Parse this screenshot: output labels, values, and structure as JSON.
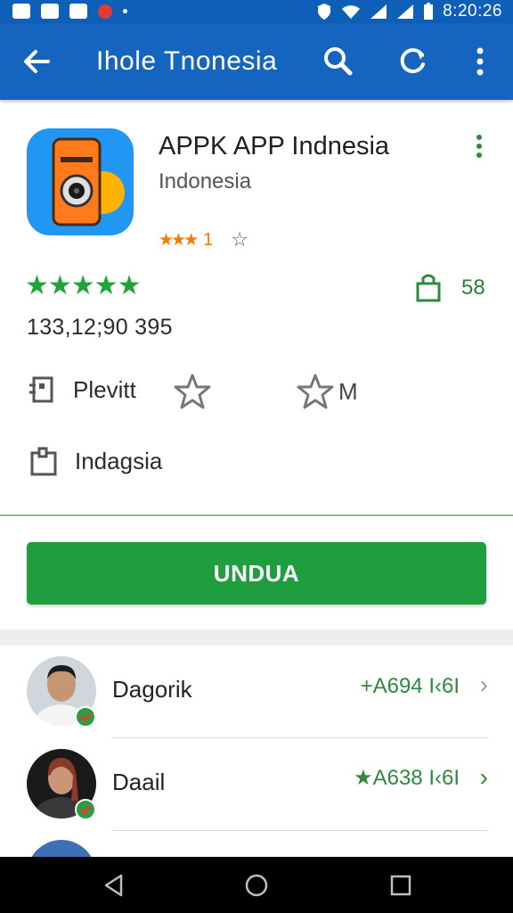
{
  "status_bar": {
    "time": "8:20:26"
  },
  "app_bar": {
    "title": "Ihole Tnonesia",
    "back_icon": "arrow-back-icon",
    "search_icon": "search-icon",
    "refresh_icon": "refresh-icon",
    "overflow_icon": "more-vert-icon"
  },
  "app": {
    "name": "APPK APP Indnesia",
    "developer": "Indonesia",
    "small_rating_stars": "★★★",
    "small_rating_count": "1",
    "big_stars": "★★★★★",
    "size_value": "58",
    "downloads": "133,12;90 395",
    "details": [
      {
        "label": "Plevitt",
        "icon": "document-icon"
      },
      {
        "label": "M",
        "icon": "star-outline-icon"
      },
      {
        "label": "Indagsia",
        "icon": "clipboard-icon"
      }
    ]
  },
  "install_button": {
    "label": "UNDUA"
  },
  "reviewers": [
    {
      "name": "Dagorik",
      "meta": "+A694 I‹6I",
      "meta_prefix_color": "#2e8b3e"
    },
    {
      "name": "Daail",
      "meta": "★A638 I‹6I",
      "meta_prefix_color": "#6d7d5d"
    }
  ],
  "colors": {
    "appbar": "#1565c0",
    "status_bar": "#0d5fb8",
    "install": "#1f9e3d",
    "rating_green": "#1fa33a",
    "small_rating_orange": "#f57c00"
  }
}
